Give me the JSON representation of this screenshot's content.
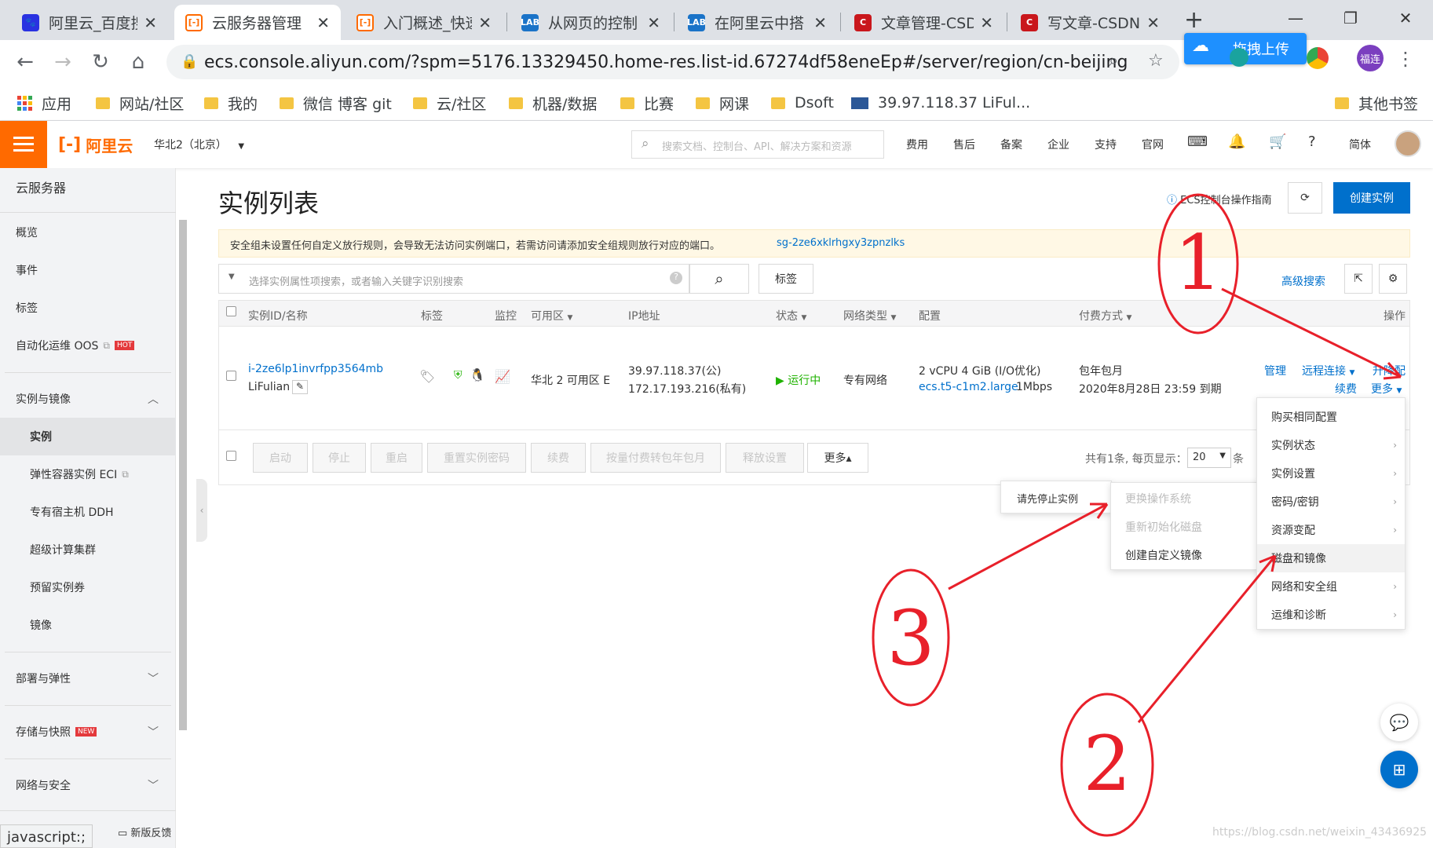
{
  "browser": {
    "tabs": [
      {
        "title": "阿里云_百度搜",
        "icon": "baidu-paw"
      },
      {
        "title": "云服务器管理",
        "icon": "aliyun-logo"
      },
      {
        "title": "入门概述_快速",
        "icon": "aliyun-logo"
      },
      {
        "title": "从网页的控制",
        "icon": "lab-logo"
      },
      {
        "title": "在阿里云中搭",
        "icon": "lab-logo"
      },
      {
        "title": "文章管理-CSD",
        "icon": "csdn-logo"
      },
      {
        "title": "写文章-CSDN",
        "icon": "csdn-logo"
      }
    ],
    "url": "ecs.console.aliyun.com/?spm=5176.13329450.home-res.list-id.67274df58eneEp#/server/region/cn-beijing",
    "upload_label": "拖拽上传",
    "profile_label": "福连",
    "bookmarks": [
      "应用",
      "网站/社区",
      "我的",
      "微信 博客 git",
      "云/社区",
      "机器/数据",
      "比赛",
      "网课",
      "Dsoft",
      "39.97.118.37 LiFul...",
      "其他书签"
    ],
    "status_text": "javascript:;"
  },
  "console": {
    "logo": "阿里云",
    "region": "华北2（北京）",
    "search_placeholder": "搜索文档、控制台、API、解决方案和资源",
    "nav": [
      "费用",
      "售后",
      "备案",
      "企业",
      "支持",
      "官网",
      "简体"
    ],
    "accent": "#ff6a00"
  },
  "sidebar": {
    "title": "云服务器",
    "items": [
      "概览",
      "事件",
      "标签",
      "自动化运维 OOS"
    ],
    "hot": "HOT",
    "section1": "实例与镜像",
    "sub_items": [
      "实例",
      "弹性容器实例 ECI",
      "专有宿主机 DDH",
      "超级计算集群",
      "预留实例券",
      "镜像"
    ],
    "sections": [
      "部署与弹性",
      "存储与快照",
      "网络与安全"
    ],
    "new_badge": "NEW",
    "feedback": "新版反馈"
  },
  "main": {
    "title": "实例列表",
    "guide_link": "ECS控制台操作指南",
    "create_button": "创建实例",
    "warning": "安全组未设置任何自定义放行规则，会导致无法访问实例端口，若需访问请添加安全组规则放行对应的端口。",
    "warning_link": "sg-2ze6xklrhgxy3zpnzlks",
    "search_placeholder": "选择实例属性项搜索，或者输入关键字识别搜索",
    "tag_button": "标签",
    "advanced_search": "高级搜索",
    "columns": [
      "实例ID/名称",
      "标签",
      "监控",
      "可用区",
      "IP地址",
      "状态",
      "网络类型",
      "配置",
      "付费方式",
      "操作"
    ],
    "row": {
      "id": "i-2ze6lp1invrfpp3564mb",
      "name": "LiFulian",
      "zone": "华北 2 可用区 E",
      "ip_public": "39.97.118.37(公)",
      "ip_private": "172.17.193.216(私有)",
      "status": "运行中",
      "network": "专有网络",
      "config_spec": "2 vCPU 4 GiB (I/O优化)",
      "config_type": "ecs.t5-c1m2.large",
      "bandwidth": "1Mbps",
      "pay_type": "包年包月",
      "expire": "2020年8月28日 23:59 到期",
      "actions": [
        "管理",
        "远程连接",
        "升降配",
        "续费",
        "更多"
      ]
    },
    "batch_buttons": [
      "启动",
      "停止",
      "重启",
      "重置实例密码",
      "续费",
      "按量付费转包年包月",
      "释放设置",
      "更多▴"
    ],
    "pagination": {
      "prefix": "共有1条, 每页显示：",
      "page_size": "20",
      "suffix": "条"
    },
    "status_color": "#1fb200"
  },
  "menus": {
    "more_menu": [
      "购买相同配置",
      "实例状态",
      "实例设置",
      "密码/密钥",
      "资源变配",
      "磁盘和镜像",
      "网络和安全组",
      "运维和诊断"
    ],
    "disk_submenu": [
      "更换操作系统",
      "重新初始化磁盘",
      "创建自定义镜像"
    ],
    "tooltip": "请先停止实例"
  },
  "annotations": {
    "labels": [
      "1",
      "2",
      "3"
    ],
    "color": "#e8202a"
  },
  "watermark": "https://blog.csdn.net/weixin_43436925"
}
